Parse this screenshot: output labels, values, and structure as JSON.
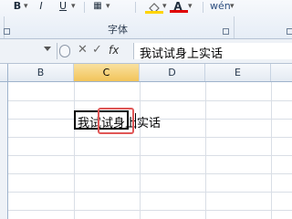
{
  "ribbon": {
    "bold_label": "B",
    "italic_label": "I",
    "underline_label": "U",
    "font_group_label": "字体",
    "fontcolor_label": "A",
    "phonetic_label": "wén",
    "fill_color": "#ffd400",
    "font_color": "#e00000"
  },
  "formula_bar": {
    "fx_label": "fx",
    "content": "我试试身上实话"
  },
  "grid": {
    "columns": [
      "B",
      "C",
      "D",
      "E"
    ],
    "selected_column": "C",
    "active_cell_text": "我试试身上实话"
  },
  "colors": {
    "highlight": "#e05656",
    "column_highlight": "#f2c45a"
  }
}
